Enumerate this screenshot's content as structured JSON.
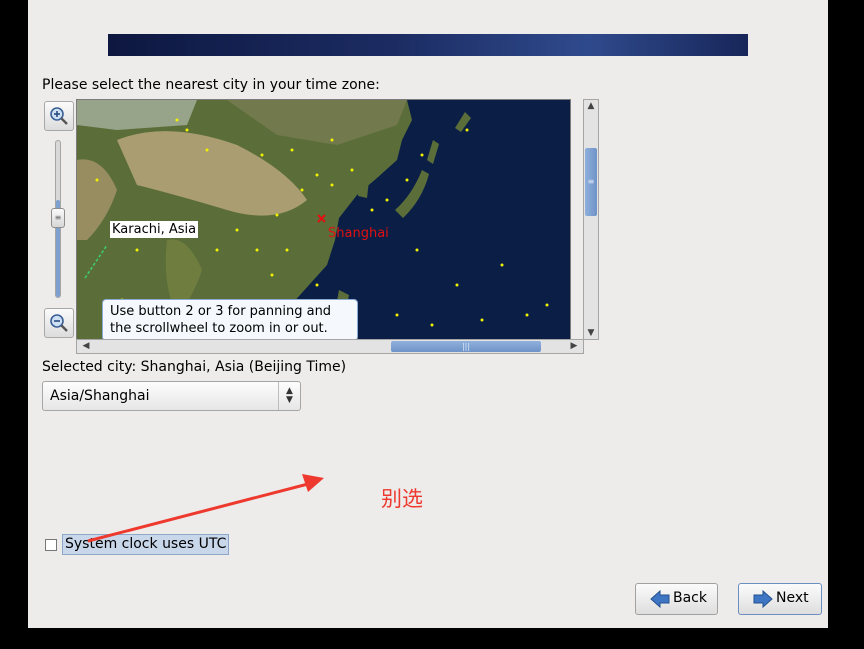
{
  "installer": {
    "prompt": "Please select the nearest city in your time zone:",
    "map": {
      "karachi_label": "Karachi, Asia",
      "shanghai_label": "Shanghai",
      "tooltip": "Use button 2 or 3 for panning and the scrollwheel to zoom in or out.",
      "zoom_level": 0.62,
      "ocean_color": "#0b1f46",
      "land_color": "#5b6e3a",
      "city_dot_color": "#f2f200",
      "selected_marker_color": "#e01010"
    },
    "selected_city_text": "Selected city: Shanghai, Asia (Beijing Time)",
    "timezone_select_value": "Asia/Shanghai",
    "utc_checkbox": {
      "label": "System clock uses UTC",
      "checked": false
    },
    "annotation_text": "别选",
    "annotation_color": "#ee3a2e",
    "buttons": {
      "back": "Back",
      "next": "Next"
    },
    "icons": [
      "zoom-in-icon",
      "zoom-out-icon",
      "back-arrow-icon",
      "next-arrow-icon"
    ]
  }
}
